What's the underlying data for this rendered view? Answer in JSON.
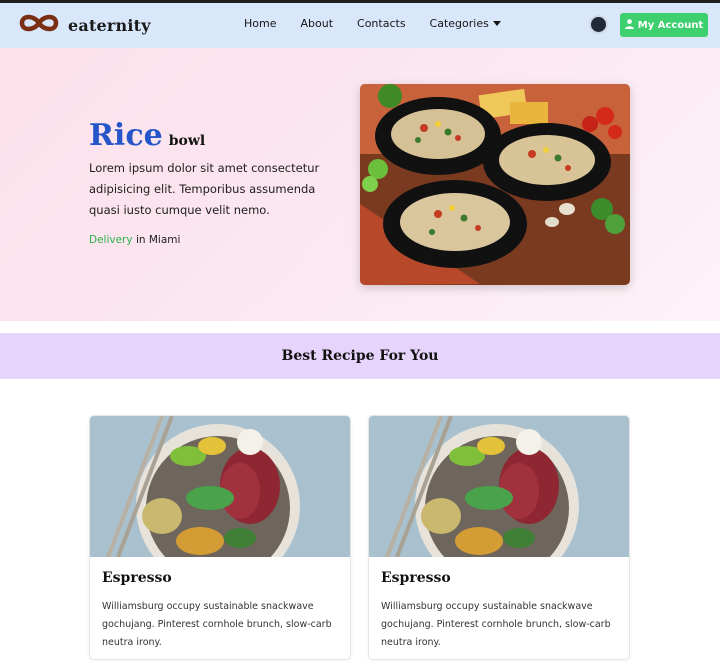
{
  "brand": {
    "name": "eaternity",
    "logo_icon": "infinity-icon",
    "logo_color": "#7a2e12"
  },
  "nav": {
    "links": [
      "Home",
      "About",
      "Contacts"
    ],
    "dropdown_label": "Categories",
    "account_label": "My Account",
    "account_color": "#3ecf6f"
  },
  "hero": {
    "title_big": "Rice",
    "title_small": "bowl",
    "description": "Lorem ipsum dolor sit amet consectetur adipisicing elit. Temporibus assumenda quasi iusto cumque velit nemo.",
    "delivery_label": "Delivery",
    "delivery_suffix": "in Miami",
    "image_alt": "rice-bowls-photo"
  },
  "section": {
    "title": "Best Recipe For You"
  },
  "cards": [
    {
      "title": "Espresso",
      "text": "Williamsburg occupy sustainable snackwave gochujang. Pinterest cornhole brunch, slow-carb neutra irony."
    },
    {
      "title": "Espresso",
      "text": "Williamsburg occupy sustainable snackwave gochujang. Pinterest cornhole brunch, slow-carb neutra irony."
    }
  ]
}
